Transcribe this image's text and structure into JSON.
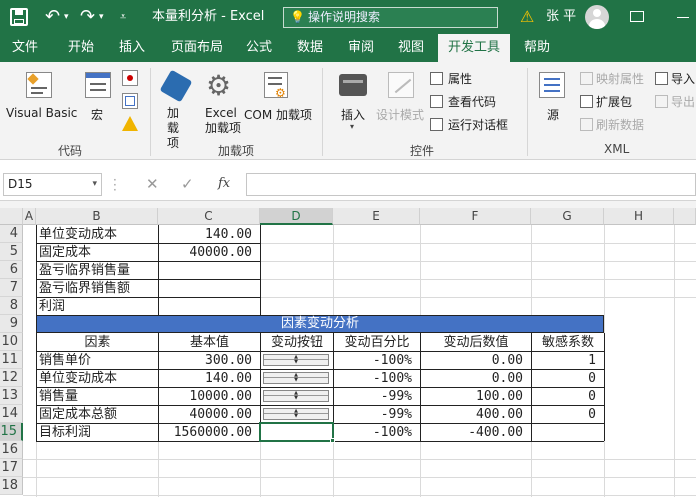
{
  "app": {
    "title": "本量利分析 - Excel",
    "search_placeholder": "操作说明搜索",
    "user_name": "张 平"
  },
  "tabs": [
    "文件",
    "开始",
    "插入",
    "页面布局",
    "公式",
    "数据",
    "审阅",
    "视图",
    "开发工具",
    "帮助"
  ],
  "active_tab": "开发工具",
  "ribbon": {
    "code_group": {
      "label": "代码",
      "visual_basic": "Visual Basic",
      "macro": "宏"
    },
    "addins_group": {
      "label": "加载项",
      "addins": "加\n载项",
      "excel_addins": "Excel\n加载项",
      "com_addins": "COM 加载项"
    },
    "controls_group": {
      "label": "控件",
      "insert": "插入",
      "design_mode": "设计模式",
      "properties": "属性",
      "view_code": "查看代码",
      "run_dialog": "运行对话框"
    },
    "source_group": {
      "source": "源",
      "map_properties": "映射属性",
      "expansion_packs": "扩展包",
      "refresh_data": "刷新数据",
      "import": "导入",
      "export": "导出",
      "label": "XML"
    }
  },
  "formula_bar": {
    "name_box": "D15",
    "fx": "fx",
    "content": ""
  },
  "columns": [
    "A",
    "B",
    "C",
    "D",
    "E",
    "F",
    "G",
    "H"
  ],
  "selected_column": "D",
  "selected_row": "15",
  "rows": {
    "r4": {
      "num": "4",
      "B": "单位变动成本",
      "C": "140.00"
    },
    "r5": {
      "num": "5",
      "B": "固定成本",
      "C": "40000.00"
    },
    "r6": {
      "num": "6",
      "B": "盈亏临界销售量",
      "C": ""
    },
    "r7": {
      "num": "7",
      "B": "盈亏临界销售额",
      "C": ""
    },
    "r8": {
      "num": "8",
      "B": "利润",
      "C": ""
    },
    "r9": {
      "num": "9",
      "title": "因素变动分析"
    },
    "r10": {
      "num": "10",
      "B": "因素",
      "C": "基本值",
      "D": "变动按钮",
      "E": "变动百分比",
      "F": "变动后数值",
      "G": "敏感系数"
    },
    "r11": {
      "num": "11",
      "B": "销售单价",
      "C": "300.00",
      "E": "-100%",
      "F": "0.00",
      "G": "1"
    },
    "r12": {
      "num": "12",
      "B": "单位变动成本",
      "C": "140.00",
      "E": "-100%",
      "F": "0.00",
      "G": "0"
    },
    "r13": {
      "num": "13",
      "B": "销售量",
      "C": "10000.00",
      "E": "-99%",
      "F": "100.00",
      "G": "0"
    },
    "r14": {
      "num": "14",
      "B": "固定成本总额",
      "C": "40000.00",
      "E": "-99%",
      "F": "400.00",
      "G": "0"
    },
    "r15": {
      "num": "15",
      "B": "目标利润",
      "C": "1560000.00",
      "E": "-100%",
      "F": "-400.00",
      "G": ""
    },
    "r16": {
      "num": "16"
    },
    "r17": {
      "num": "17"
    },
    "r18": {
      "num": "18"
    }
  },
  "colors": {
    "brand": "#217346",
    "section_header": "#4472c4"
  }
}
